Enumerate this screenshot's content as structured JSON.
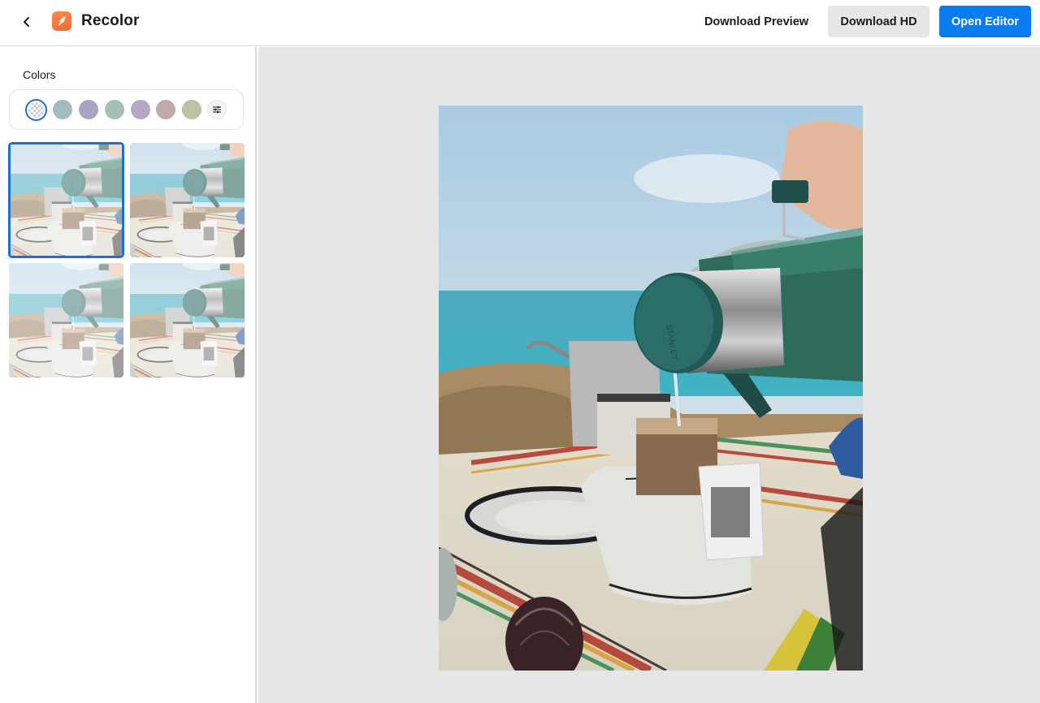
{
  "header": {
    "title": "Recolor",
    "back_icon": "chevron-left-icon",
    "logo_icon": "brush-icon",
    "download_preview_label": "Download Preview",
    "download_hd_label": "Download HD",
    "open_editor_label": "Open Editor",
    "accent_color": "#0a7cf0",
    "logo_color": "#f5773a"
  },
  "sidebar": {
    "colors_label": "Colors",
    "swatches": [
      {
        "name": "transparent",
        "color": "transparent",
        "selected": true
      },
      {
        "name": "slate-teal",
        "color": "#a3bcc1",
        "selected": false
      },
      {
        "name": "lavender",
        "color": "#a9a4c6",
        "selected": false
      },
      {
        "name": "sage-green",
        "color": "#a4c0b5",
        "selected": false
      },
      {
        "name": "lilac",
        "color": "#b7a6c6",
        "selected": false
      },
      {
        "name": "dusty-rose",
        "color": "#c3aaa8",
        "selected": false
      },
      {
        "name": "olive-sage",
        "color": "#bcc2a4",
        "selected": false
      }
    ],
    "adjust_icon": "sliders-icon",
    "variations": [
      {
        "label": "variation-1",
        "selected": true
      },
      {
        "label": "variation-2",
        "selected": false
      },
      {
        "label": "variation-3",
        "selected": false
      },
      {
        "label": "variation-4",
        "selected": false
      }
    ]
  },
  "preview": {
    "description": "Coffee being poured from a green Stanley thermos into a drip bag over a white pitcher on a striped cloth, sea in the background",
    "thermos_text": "STANLEY"
  }
}
